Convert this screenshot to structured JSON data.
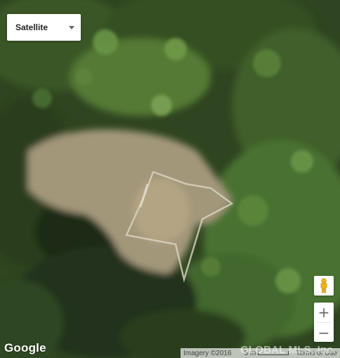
{
  "map": {
    "type_control": {
      "selected": "Satellite"
    },
    "logo": "Google",
    "imagery": "Imagery ©2016",
    "scale": "5 m",
    "terms": "Terms of Use",
    "watermark": "GLOBAL MLS, Inc."
  },
  "controls": {
    "zoom_in": "+",
    "zoom_out": "−"
  },
  "colors": {
    "foliage_dark": "#24341a",
    "foliage_mid": "#3f5a2a",
    "foliage_light": "#5f8a3c",
    "clearing": "#a89a76",
    "pegman": "#f2b31a"
  },
  "icons": {
    "map_type": "chevron-down-icon",
    "street_view": "pegman-icon"
  }
}
